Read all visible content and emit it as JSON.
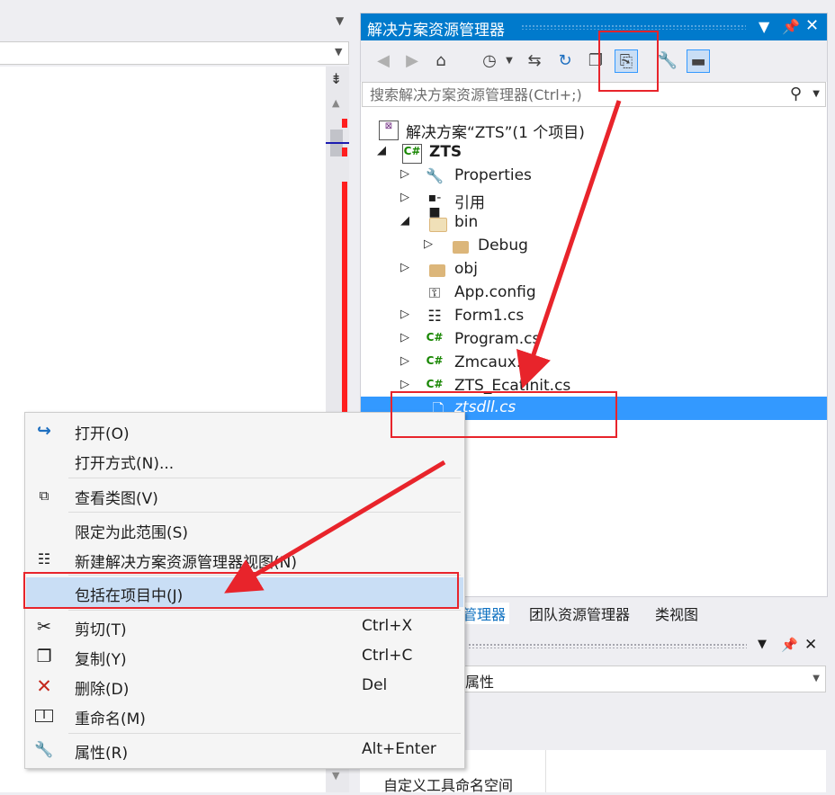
{
  "solution_explorer": {
    "title": "解决方案资源管理器",
    "search_placeholder": "搜索解决方案资源管理器(Ctrl+;)",
    "tree": [
      {
        "label": "解决方案“ZTS”(1 个项目)",
        "icon": "solution-icon"
      },
      {
        "label": "ZTS",
        "icon": "csharp-project-icon"
      },
      {
        "label": "Properties",
        "icon": "wrench-icon"
      },
      {
        "label": "引用",
        "icon": "references-icon"
      },
      {
        "label": "bin",
        "icon": "folder-icon"
      },
      {
        "label": "Debug",
        "icon": "folder-icon"
      },
      {
        "label": "obj",
        "icon": "folder-icon"
      },
      {
        "label": "App.config",
        "icon": "config-icon"
      },
      {
        "label": "Form1.cs",
        "icon": "form-icon"
      },
      {
        "label": "Program.cs",
        "icon": "cs-file-icon"
      },
      {
        "label": "Zmcaux.cs",
        "icon": "cs-file-icon"
      },
      {
        "label": "ZTS_EcatInit.cs",
        "icon": "cs-file-icon"
      },
      {
        "label": "ztsdll.cs",
        "icon": "excluded-file-icon"
      }
    ]
  },
  "tabs": [
    "管理器",
    "团队资源管理器",
    "类视图"
  ],
  "properties": {
    "combo_value": "属性",
    "row_label": "自定义工具命名空间"
  },
  "context_menu": {
    "items": [
      {
        "label": "打开(O)",
        "shortcut": "",
        "icon": "open-arrow-icon"
      },
      {
        "label": "打开方式(N)...",
        "shortcut": "",
        "icon": ""
      },
      {
        "label": "查看类图(V)",
        "shortcut": "",
        "icon": "class-diagram-icon"
      },
      {
        "label": "限定为此范围(S)",
        "shortcut": "",
        "icon": ""
      },
      {
        "label": "新建解决方案资源管理器视图(N)",
        "shortcut": "",
        "icon": "new-view-icon"
      },
      {
        "label": "包括在项目中(J)",
        "shortcut": "",
        "icon": ""
      },
      {
        "label": "剪切(T)",
        "shortcut": "Ctrl+X",
        "icon": "scissors-icon"
      },
      {
        "label": "复制(Y)",
        "shortcut": "Ctrl+C",
        "icon": "copy-icon"
      },
      {
        "label": "删除(D)",
        "shortcut": "Del",
        "icon": "delete-x-icon"
      },
      {
        "label": "重命名(M)",
        "shortcut": "",
        "icon": "rename-icon"
      },
      {
        "label": "属性(R)",
        "shortcut": "Alt+Enter",
        "icon": "wrench-icon"
      }
    ]
  },
  "colors": {
    "accent": "#007acc",
    "selection": "#3399ff",
    "menu_highlight": "#c9def5",
    "annotation_red": "#e8242b"
  }
}
